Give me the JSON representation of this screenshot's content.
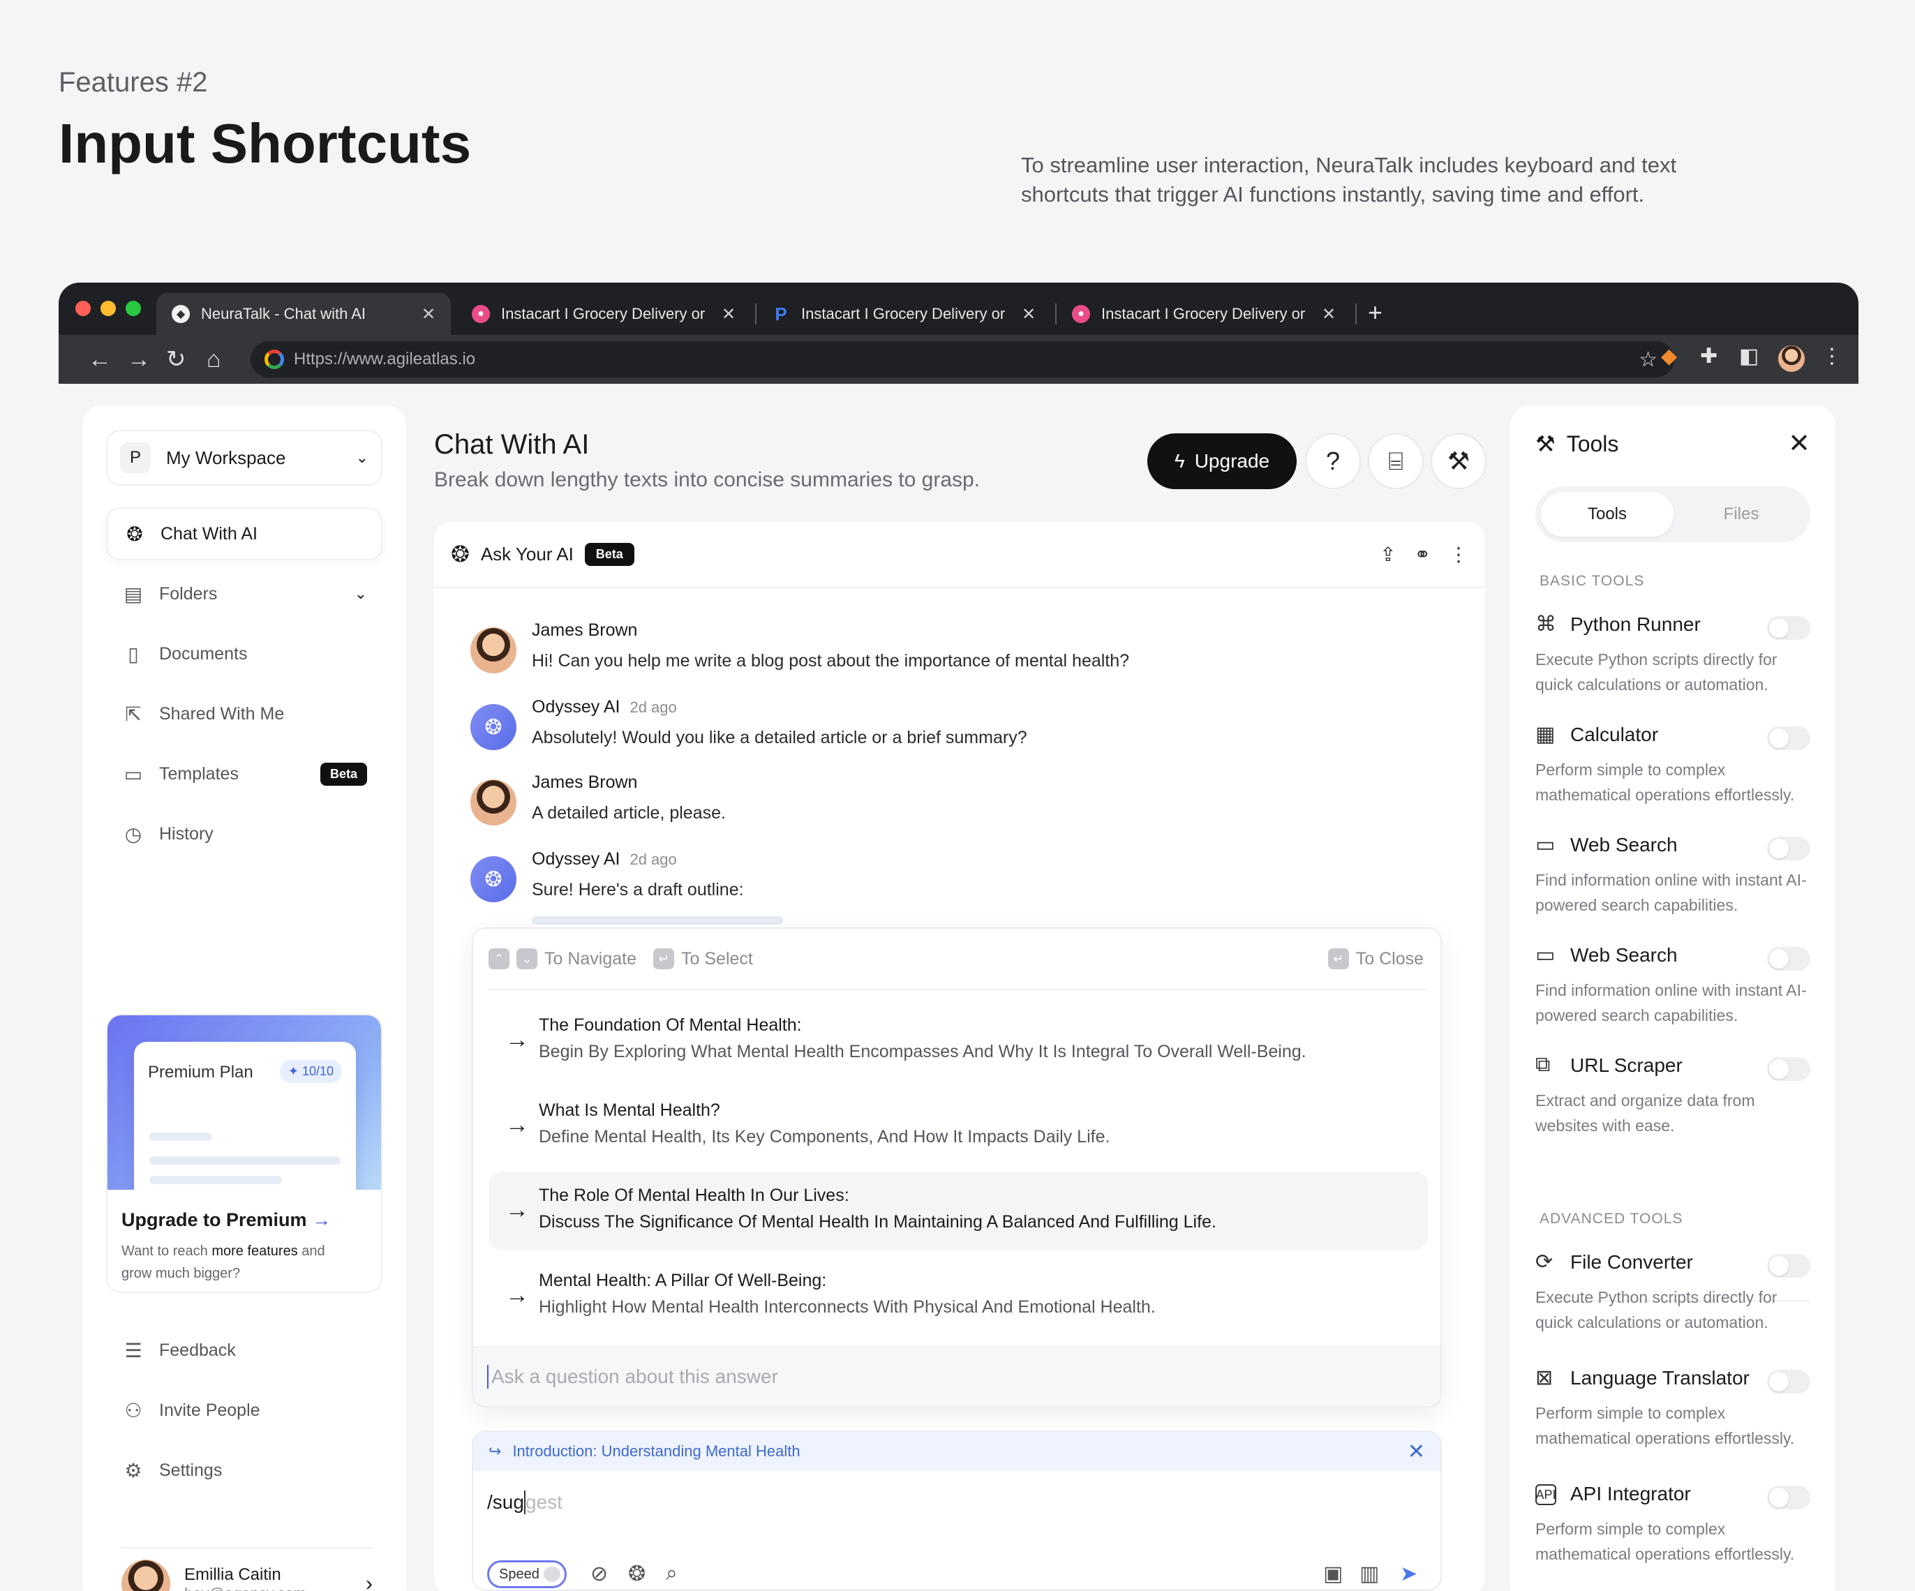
{
  "hero": {
    "kicker": "Features #2",
    "title": "Input Shortcuts",
    "description": "To streamline user interaction, NeuraTalk includes keyboard and text shortcuts that trigger AI functions instantly, saving time and effort."
  },
  "browser": {
    "tabs": [
      {
        "title": "NeuraTalk - Chat with AI",
        "favicon": "neuratalk-icon",
        "active": true
      },
      {
        "title": "Instacart I Grocery Delivery or",
        "favicon": "dribbble-icon"
      },
      {
        "title": "Instacart I Grocery Delivery or",
        "favicon": "paypal-icon"
      },
      {
        "title": "Instacart I Grocery Delivery or",
        "favicon": "dribbble-icon"
      }
    ],
    "url": "Https://www.agileatlas.io",
    "colors": {
      "traffic_red": "#ff5f57",
      "traffic_yellow": "#febc2e",
      "traffic_green": "#28c840"
    }
  },
  "sidebar": {
    "workspace_initial": "P",
    "workspace_name": "My Workspace",
    "items": [
      {
        "label": "Chat With AI",
        "icon": "openai-icon"
      },
      {
        "label": "Folders",
        "icon": "folder-icon"
      },
      {
        "label": "Documents",
        "icon": "document-icon"
      },
      {
        "label": "Shared With Me",
        "icon": "share-icon"
      },
      {
        "label": "Templates",
        "icon": "template-icon",
        "badge": "Beta"
      },
      {
        "label": "History",
        "icon": "history-icon"
      }
    ],
    "promo": {
      "plan": "Premium Plan",
      "plan_badge": "10/10",
      "heading": "Upgrade to Premium",
      "desc_before": "Want to reach",
      "desc_bold": "more features",
      "desc_after": "and grow much bigger?"
    },
    "bottom_items": [
      {
        "label": "Feedback",
        "icon": "feedback-icon"
      },
      {
        "label": "Invite People",
        "icon": "invite-icon"
      },
      {
        "label": "Settings",
        "icon": "settings-icon"
      }
    ],
    "user": {
      "name": "Emillia Caitin",
      "email": "hey@agency.com"
    }
  },
  "main": {
    "title": "Chat With AI",
    "subtitle": "Break down lengthy texts into concise summaries to grasp.",
    "upgrade_label": "Upgrade",
    "chat_header": {
      "title": "Ask Your AI",
      "badge": "Beta"
    },
    "messages": [
      {
        "author": "James Brown",
        "time": "",
        "text": "Hi! Can you help me write a blog post about the importance of mental health?",
        "bot": false
      },
      {
        "author": "Odyssey AI",
        "time": "2d ago",
        "text": "Absolutely! Would you like a detailed article or a brief summary?",
        "bot": true
      },
      {
        "author": "James Brown",
        "time": "",
        "text": "A detailed article, please.",
        "bot": false
      },
      {
        "author": "Odyssey AI",
        "time": "2d ago",
        "text": "Sure! Here's a draft outline:",
        "bot": true
      }
    ],
    "popup": {
      "hint_navigate": "To Navigate",
      "hint_select": "To Select",
      "hint_close": "To Close",
      "suggestions": [
        {
          "title": "The Foundation Of Mental Health:",
          "desc": "Begin By Exploring What Mental Health Encompasses And Why It Is Integral To Overall Well-Being."
        },
        {
          "title": "What Is Mental Health?",
          "desc": "Define Mental Health, Its Key Components, And How It Impacts Daily Life."
        },
        {
          "title": "The Role Of Mental Health In Our Lives:",
          "desc": "Discuss The Significance Of Mental Health In Maintaining A Balanced And Fulfilling Life."
        },
        {
          "title": "Mental Health: A Pillar Of Well-Being:",
          "desc": "Highlight How Mental Health Interconnects With Physical And Emotional Health."
        }
      ],
      "input_placeholder": "Ask a question about this answer"
    },
    "composer": {
      "context": "Introduction: Understanding Mental Health",
      "typed": "/sug",
      "ghost": "gest",
      "speed_label": "Speed"
    }
  },
  "tools": {
    "title": "Tools",
    "tabs": [
      "Tools",
      "Files"
    ],
    "basic_label": "BASIC TOOLS",
    "advanced_label": "ADVANCED TOOLS",
    "basic": [
      {
        "name": "Python Runner",
        "icon": "python-icon",
        "desc": "Execute Python scripts directly for quick calculations or automation.",
        "enabled": false
      },
      {
        "name": "Calculator",
        "icon": "calculator-icon",
        "desc": "Perform simple to complex mathematical operations effortlessly.",
        "enabled": false
      },
      {
        "name": "Web Search",
        "icon": "browser-icon",
        "desc": "Find information online with instant AI-powered search capabilities.",
        "enabled": false
      },
      {
        "name": "Web Search",
        "icon": "browser-icon",
        "desc": "Find information online with instant AI-powered search capabilities.",
        "enabled": false
      },
      {
        "name": "URL Scraper",
        "icon": "scraper-icon",
        "desc": "Extract and organize data from websites with ease.",
        "enabled": false
      }
    ],
    "advanced": [
      {
        "name": "File Converter",
        "icon": "convert-icon",
        "desc": "Execute Python scripts directly for quick calculations or automation.",
        "enabled": false
      },
      {
        "name": "Language Translator",
        "icon": "translate-icon",
        "desc": "Perform simple to complex mathematical operations effortlessly.",
        "enabled": false
      },
      {
        "name": "API Integrator",
        "icon": "api-icon",
        "desc": "Perform simple to complex mathematical operations effortlessly.",
        "enabled": false
      }
    ]
  }
}
